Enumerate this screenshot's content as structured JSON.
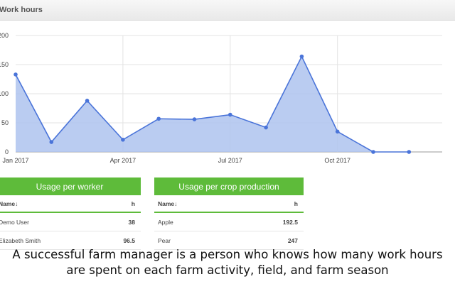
{
  "panel": {
    "title": "Work hours"
  },
  "chart_data": {
    "type": "area",
    "x": [
      "Jan 2017",
      "Feb 2017",
      "Mar 2017",
      "Apr 2017",
      "May 2017",
      "Jun 2017",
      "Jul 2017",
      "Aug 2017",
      "Sep 2017",
      "Oct 2017",
      "Nov 2017",
      "Dec 2017"
    ],
    "values": [
      133,
      17,
      88,
      21,
      57,
      56,
      64,
      42,
      164,
      35,
      0,
      0
    ],
    "xticks": [
      "Jan 2017",
      "Apr 2017",
      "Jul 2017",
      "Oct 2017"
    ],
    "yticks": [
      "0",
      "50",
      "100",
      "150",
      "200"
    ],
    "ylim": [
      0,
      200
    ],
    "title": "",
    "xlabel": "",
    "ylabel": "",
    "grid": true,
    "line_color": "#4a74d9",
    "fill_color": "#aec3ee"
  },
  "workers_table": {
    "title": "Usage per worker",
    "col_name": "Name↓",
    "col_value": "h",
    "rows": [
      {
        "name": "Demo User",
        "value": "38"
      },
      {
        "name": "Elizabeth Smith",
        "value": "96.5"
      }
    ]
  },
  "crops_table": {
    "title": "Usage per crop production",
    "col_name": "Name↓",
    "col_value": "h",
    "rows": [
      {
        "name": "Apple",
        "value": "192.5"
      },
      {
        "name": "Pear",
        "value": "247"
      }
    ]
  },
  "caption": {
    "line1": "A successful farm manager is a person who knows how many work hours",
    "line2": "are spent on each farm activity, field, and farm season"
  },
  "colors": {
    "accent": "#5ebb3a",
    "series": "#4a74d9"
  }
}
